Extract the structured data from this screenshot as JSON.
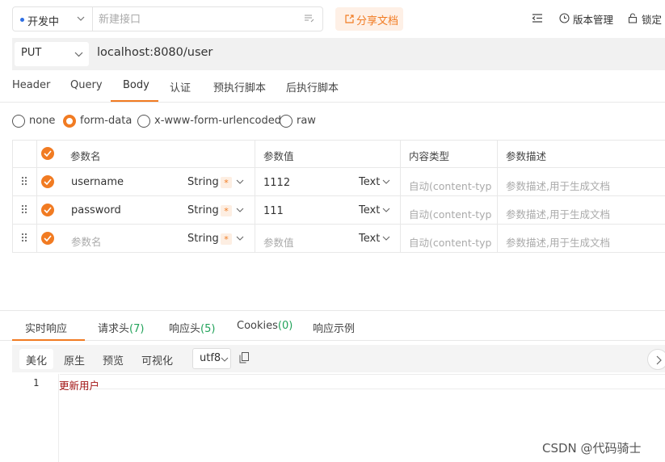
{
  "top": {
    "status": "开发中",
    "name_placeholder": "新建接口",
    "share_label": "分享文档",
    "version_label": "版本管理",
    "lock_label": "锁定"
  },
  "request": {
    "method": "PUT",
    "url": "localhost:8080/user",
    "tabs": [
      "Header",
      "Query",
      "Body",
      "认证",
      "预执行脚本",
      "后执行脚本"
    ],
    "active_tab": "Body"
  },
  "body_types": [
    "none",
    "form-data",
    "x-www-form-urlencoded",
    "raw"
  ],
  "selected_body_type": "form-data",
  "params_table": {
    "headers": [
      "参数名",
      "参数值",
      "内容类型",
      "参数描述"
    ],
    "rows": [
      {
        "name": "username",
        "type": "String",
        "required": "*",
        "value": "1112",
        "content_kind": "Text",
        "content_type_ph": "自动(content-typ",
        "desc_ph": "参数描述,用于生成文档"
      },
      {
        "name": "password",
        "type": "String",
        "required": "*",
        "value": "111",
        "content_kind": "Text",
        "content_type_ph": "自动(content-typ",
        "desc_ph": "参数描述,用于生成文档"
      },
      {
        "name_ph": "参数名",
        "type": "String",
        "required": "*",
        "value_ph": "参数值",
        "content_kind": "Text",
        "content_type_ph": "自动(content-typ",
        "desc_ph": "参数描述,用于生成文档"
      }
    ]
  },
  "response": {
    "tabs": [
      {
        "label": "实时响应",
        "count": ""
      },
      {
        "label": "请求头",
        "count": "(7)"
      },
      {
        "label": "响应头",
        "count": "(5)"
      },
      {
        "label": "Cookies",
        "count": "(0)"
      },
      {
        "label": "响应示例",
        "count": ""
      }
    ],
    "formats": [
      "美化",
      "原生",
      "预览",
      "可视化"
    ],
    "encoding": "utf8",
    "lines": [
      {
        "no": "1",
        "text": "更新用户"
      }
    ]
  },
  "watermark": "CSDN @代码骑士",
  "colors": {
    "accent": "#f17b22",
    "count_green": "#22a35a",
    "code_red": "#a31515"
  }
}
